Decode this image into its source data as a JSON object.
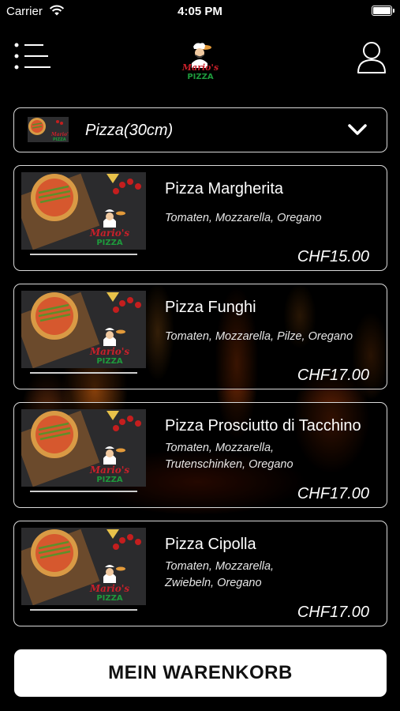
{
  "status_bar": {
    "carrier": "Carrier",
    "time": "4:05 PM"
  },
  "header": {
    "logo_top": "Mario's",
    "logo_bottom": "PIZZA"
  },
  "category": {
    "label": "Pizza(30cm)"
  },
  "products": [
    {
      "name": "Pizza Margherita",
      "desc_line1": "Tomaten, Mozzarella, Oregano",
      "desc_line2": "",
      "price": "CHF15.00",
      "logo_top": "Mario's",
      "logo_bottom": "PIZZA"
    },
    {
      "name": "Pizza Funghi",
      "desc_line1": "Tomaten, Mozzarella, Pilze, Oregano",
      "desc_line2": "",
      "price": "CHF17.00",
      "logo_top": "Mario's",
      "logo_bottom": "PIZZA"
    },
    {
      "name": "Pizza Prosciutto di Tacchino",
      "desc_line1": "Tomaten, Mozzarella,",
      "desc_line2": "Trutenschinken, Oregano",
      "price": "CHF17.00",
      "logo_top": "Mario's",
      "logo_bottom": "PIZZA"
    },
    {
      "name": "Pizza Cipolla",
      "desc_line1": "Tomaten, Mozzarella,",
      "desc_line2": "Zwiebeln, Oregano",
      "price": "CHF17.00",
      "logo_top": "Mario's",
      "logo_bottom": "PIZZA"
    }
  ],
  "cart": {
    "label": "MEIN WARENKORB"
  },
  "colors": {
    "background": "#000000",
    "border": "#d9d9d9",
    "logo_red": "#c8202a",
    "logo_green": "#1e9a3c",
    "button": "#ffffff"
  }
}
